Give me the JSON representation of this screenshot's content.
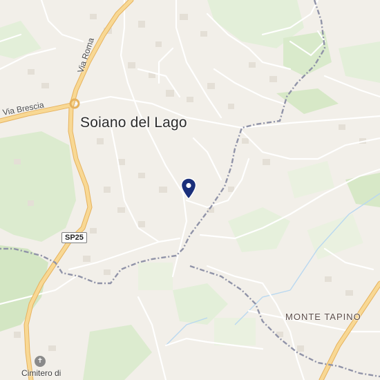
{
  "map": {
    "labels": {
      "town": "Soiano del Lago",
      "road_via_brescia": "Via Brescia",
      "road_via_roma": "Via Roma",
      "road_shield": "SP25",
      "peak": "MONTE TAPINO",
      "cemetery": "Cimitero di"
    },
    "icons": {
      "location_pin": "map-pin-icon",
      "cemetery": "cemetery-icon"
    },
    "colors": {
      "background": "#f2efe9",
      "major_road": "#f7d38c",
      "major_road_casing": "#e6b25e",
      "minor_road": "#ffffff",
      "boundary": "#8c8fa6",
      "green": "#d7e8c7",
      "water": "#b9d8f0",
      "pin": "#1a2f7a"
    }
  }
}
